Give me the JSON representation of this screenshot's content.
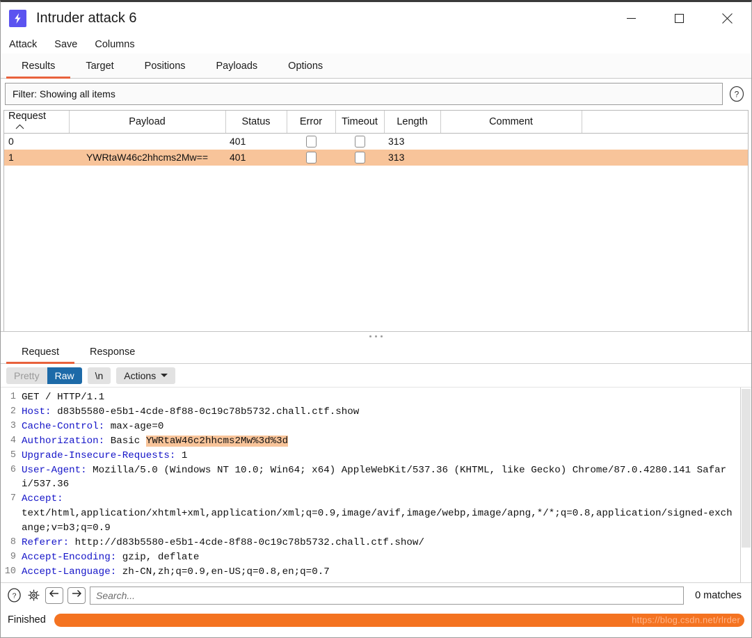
{
  "window": {
    "title": "Intruder attack 6",
    "icon": "lightning-bolt-icon",
    "minimize_label": "minimize",
    "maximize_label": "maximize",
    "close_label": "close"
  },
  "menu": {
    "items": [
      {
        "label": "Attack"
      },
      {
        "label": "Save"
      },
      {
        "label": "Columns"
      }
    ]
  },
  "tabs": {
    "items": [
      {
        "label": "Results",
        "active": true
      },
      {
        "label": "Target",
        "active": false
      },
      {
        "label": "Positions",
        "active": false
      },
      {
        "label": "Payloads",
        "active": false
      },
      {
        "label": "Options",
        "active": false
      }
    ]
  },
  "filter": {
    "text": "Filter: Showing all items",
    "help_icon": "question-circle-icon"
  },
  "results_table": {
    "columns": [
      {
        "label": "Request",
        "sort": "asc"
      },
      {
        "label": "Payload"
      },
      {
        "label": "Status"
      },
      {
        "label": "Error"
      },
      {
        "label": "Timeout"
      },
      {
        "label": "Length"
      },
      {
        "label": "Comment"
      },
      {
        "label": ""
      }
    ],
    "rows": [
      {
        "request": "0",
        "payload": "",
        "status": "401",
        "error": false,
        "timeout": false,
        "length": "313",
        "comment": "",
        "selected": false
      },
      {
        "request": "1",
        "payload": "YWRtaW46c2hhcms2Mw==",
        "status": "401",
        "error": false,
        "timeout": false,
        "length": "313",
        "comment": "",
        "selected": true
      }
    ]
  },
  "message_tabs": {
    "items": [
      {
        "label": "Request",
        "active": true
      },
      {
        "label": "Response",
        "active": false
      }
    ]
  },
  "editor_toolbar": {
    "pretty_label": "Pretty",
    "raw_label": "Raw",
    "newline_label": "\\n",
    "actions_label": "Actions",
    "actions_caret": "chevron-down-icon"
  },
  "request": {
    "lines": [
      {
        "n": "1",
        "header": "",
        "value": "GET / HTTP/1.1"
      },
      {
        "n": "2",
        "header": "Host:",
        "value": " d83b5580-e5b1-4cde-8f88-0c19c78b5732.chall.ctf.show"
      },
      {
        "n": "3",
        "header": "Cache-Control:",
        "value": " max-age=0"
      },
      {
        "n": "4",
        "header": "Authorization:",
        "value": " Basic ",
        "highlight": "YWRtaW46c2hhcms2Mw%3d%3d"
      },
      {
        "n": "5",
        "header": "Upgrade-Insecure-Requests:",
        "value": " 1"
      },
      {
        "n": "6",
        "header": "User-Agent:",
        "value": " Mozilla/5.0 (Windows NT 10.0; Win64; x64) AppleWebKit/537.36 (KHTML, like Gecko) Chrome/87.0.4280.141 Safari/537.36"
      },
      {
        "n": "7",
        "header": "Accept:",
        "value": "\ntext/html,application/xhtml+xml,application/xml;q=0.9,image/avif,image/webp,image/apng,*/*;q=0.8,application/signed-exchange;v=b3;q=0.9"
      },
      {
        "n": "8",
        "header": "Referer:",
        "value": " http://d83b5580-e5b1-4cde-8f88-0c19c78b5732.chall.ctf.show/"
      },
      {
        "n": "9",
        "header": "Accept-Encoding:",
        "value": " gzip, deflate"
      },
      {
        "n": "10",
        "header": "Accept-Language:",
        "value": " zh-CN,zh;q=0.9,en-US;q=0.8,en;q=0.7"
      }
    ]
  },
  "search": {
    "help_icon": "question-circle-icon",
    "settings_icon": "gear-icon",
    "prev_icon": "arrow-left-icon",
    "next_icon": "arrow-right-icon",
    "placeholder": "Search...",
    "value": "",
    "matches": "0 matches"
  },
  "status": {
    "text": "Finished",
    "progress_percent": 100,
    "watermark": "https://blog.csdn.net/rlrder"
  },
  "colors": {
    "accent_orange": "#e8613c",
    "progress_orange": "#f47321",
    "row_highlight": "#f8c49a",
    "raw_active_blue": "#1d6aa8",
    "header_blue": "#1414c8",
    "app_icon_purple": "#5b53f0"
  }
}
